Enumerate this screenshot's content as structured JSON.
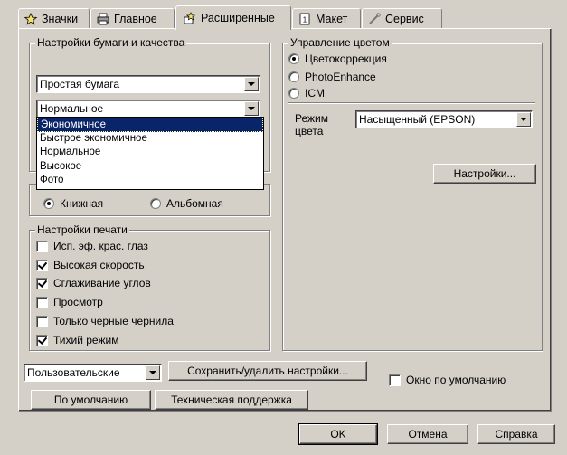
{
  "tabs": [
    {
      "label": "Значки",
      "icon": "star-icon"
    },
    {
      "label": "Главное",
      "icon": "printer-icon"
    },
    {
      "label": "Расширенные",
      "icon": "advanced-icon"
    },
    {
      "label": "Макет",
      "icon": "layout-icon"
    },
    {
      "label": "Сервис",
      "icon": "wrench-icon"
    }
  ],
  "paper": {
    "legend": "Настройки бумаги и качества",
    "paper_type": "Простая бумага",
    "quality": "Нормальное",
    "quality_options": [
      "Экономичное",
      "Быстрое экономичное",
      "Нормальное",
      "Высокое",
      "Фото"
    ],
    "selected_option": "Экономичное"
  },
  "orientation": {
    "portrait": "Книжная",
    "landscape": "Альбомная"
  },
  "print_settings": {
    "legend": "Настройки печати",
    "items": [
      {
        "label": "Исп. эф. крас. глаз",
        "checked": false
      },
      {
        "label": "Высокая скорость",
        "checked": true
      },
      {
        "label": "Сглаживание углов",
        "checked": true
      },
      {
        "label": "Просмотр",
        "checked": false
      },
      {
        "label": "Только черные чернила",
        "checked": false
      },
      {
        "label": "Тихий режим",
        "checked": true
      }
    ]
  },
  "color": {
    "legend": "Управление цветом",
    "options": [
      "Цветокоррекция",
      "PhotoEnhance",
      "ICM"
    ],
    "selected": "Цветокоррекция",
    "mode_label_1": "Режим",
    "mode_label_2": "цвета",
    "mode_value": "Насыщенный (EPSON)",
    "settings_button": "Настройки..."
  },
  "bottom": {
    "preset": "Пользовательские",
    "save_button": "Сохранить/удалить настройки...",
    "default_window": "Окно по умолчанию",
    "defaults_button": "По умолчанию",
    "support_button": "Техническая поддержка"
  },
  "dialog": {
    "ok": "OK",
    "cancel": "Отмена",
    "help": "Справка"
  }
}
